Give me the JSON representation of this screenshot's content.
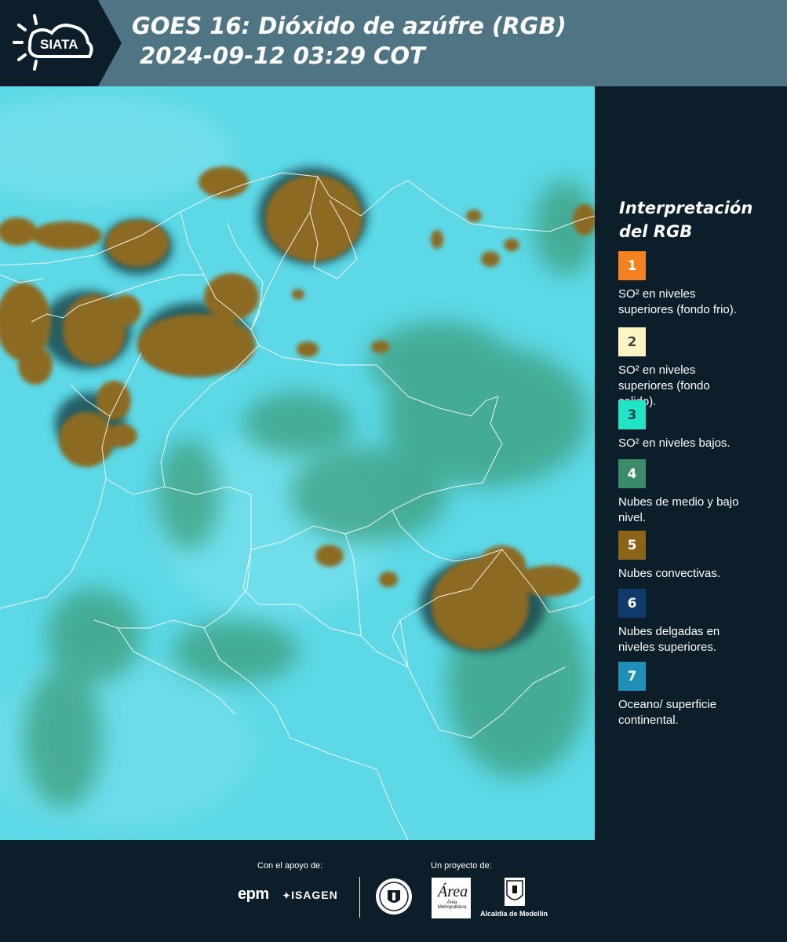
{
  "header": {
    "logo_text": "SIATA",
    "title_line1": "GOES 16: Dióxido de azúfre (RGB)",
    "title_line2": " 2024-09-12 03:29 COT"
  },
  "legend": {
    "title_line1": "Interpretación",
    "title_line2": "del RGB",
    "items": [
      {
        "number": "1",
        "color": "#f58220",
        "text_line1": "SO² en niveles",
        "text_line2": "superiores (fondo frio)."
      },
      {
        "number": "2",
        "color": "#fff5c2",
        "text_line1": "SO² en niveles",
        "text_line2": "superiores (fondo",
        "text_line3": "calido)."
      },
      {
        "number": "3",
        "color": "#21e3c6",
        "text_line1": "SO² en niveles bajos."
      },
      {
        "number": "4",
        "color": "#3a8c68",
        "text_line1": "Nubes de medio y bajo",
        "text_line2": "nivel."
      },
      {
        "number": "5",
        "color": "#8c6418",
        "text_line1": "Nubes convectivas."
      },
      {
        "number": "6",
        "color": "#0f3a6b",
        "text_line1": "Nubes delgadas en",
        "text_line2": "niveles superiores."
      },
      {
        "number": "7",
        "color": "#1f8fb8",
        "text_line1": "Oceano/ superficie",
        "text_line2": "continental."
      }
    ]
  },
  "footer": {
    "support_label": "Con el apoyo de:",
    "project_label": "Un proyecto de:",
    "sponsor1": "epm",
    "sponsor2": "ISAGEN",
    "partner1": "Área Metropolitana",
    "partner2": "Alcaldía de Medellín"
  },
  "map": {
    "background_color": "#55d6e4",
    "convective_color": "#8c6a22",
    "border_color": "#ffffff"
  }
}
